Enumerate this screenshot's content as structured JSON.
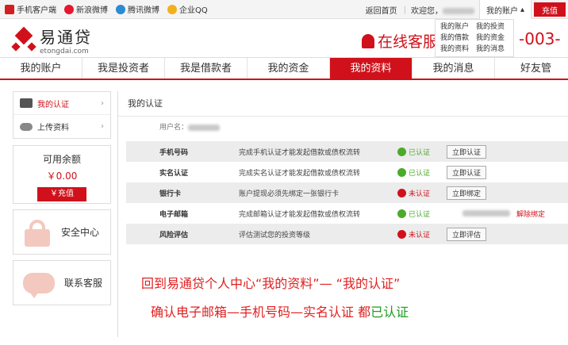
{
  "topbar": {
    "left_items": [
      {
        "label": "手机客户端",
        "icon": "phone-icon"
      },
      {
        "label": "新浪微博",
        "icon": "weibo-icon"
      },
      {
        "label": "腾讯微博",
        "icon": "tencent-weibo-icon"
      },
      {
        "label": "企业QQ",
        "icon": "qq-icon"
      }
    ],
    "home_link": "返回首页",
    "welcome": "欢迎您",
    "account_menu": "我的账户",
    "recharge": "充值"
  },
  "dropdown": {
    "items": [
      "我的账户",
      "我的投资",
      "我的借款",
      "我的资金",
      "我的资料",
      "我的消息"
    ]
  },
  "header": {
    "logo_cn": "易通贷",
    "logo_en": "etongdai.com",
    "online_service": "在线客服",
    "phone_fragment": "-003-"
  },
  "mainnav": {
    "items": [
      "我的账户",
      "我是投资者",
      "我是借款者",
      "我的资金",
      "我的资料",
      "我的消息",
      "好友管"
    ],
    "active_index": 4
  },
  "sidebar": {
    "items": [
      {
        "label": "我的认证",
        "active": true
      },
      {
        "label": "上传资料",
        "active": false
      }
    ],
    "balance_label": "可用余额",
    "balance_value": "￥0.00",
    "recharge_button": "￥充值",
    "security_center": "安全中心",
    "customer_service": "联系客服"
  },
  "content": {
    "title": "我的认证",
    "username_label": "用户名：",
    "rows": [
      {
        "name": "手机号码",
        "desc": "完成手机认证才能发起借款或债权流转",
        "status": "已认证",
        "ok": true,
        "button": "立即认证",
        "extra": ""
      },
      {
        "name": "实名认证",
        "desc": "完成实名认证才能发起借款或债权流转",
        "status": "已认证",
        "ok": true,
        "button": "立即认证",
        "extra": ""
      },
      {
        "name": "银行卡",
        "desc": "账户提现必须先绑定一张银行卡",
        "status": "未认证",
        "ok": false,
        "button": "立即绑定",
        "extra": ""
      },
      {
        "name": "电子邮箱",
        "desc": "完成邮箱认证才能发起借款或债权流转",
        "status": "已认证",
        "ok": true,
        "button": "",
        "extra": "解除绑定"
      },
      {
        "name": "风险评估",
        "desc": "评估测试您的投资等级",
        "status": "未认证",
        "ok": false,
        "button": "立即评估",
        "extra": ""
      }
    ]
  },
  "notes": {
    "line1": "回到易通贷个人中心“我的资料”— “我的认证”",
    "line2_prefix": "确认电子邮箱—手机号码—实名认证  都",
    "line2_green": "已认证"
  },
  "colors": {
    "brand_red": "#d0111b",
    "ok_green": "#4caa2b"
  }
}
